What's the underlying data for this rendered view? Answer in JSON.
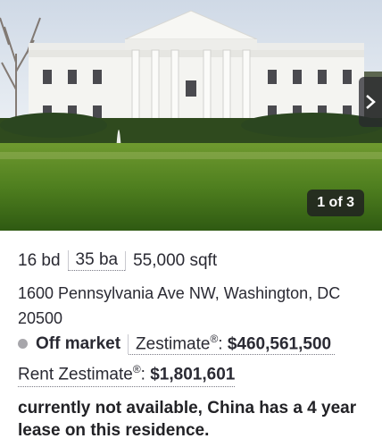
{
  "gallery": {
    "counter": "1 of 3",
    "next_icon": "chevron-right-icon"
  },
  "listing": {
    "beds": "16 bd",
    "baths": "35 ba",
    "sqft": "55,000 sqft",
    "address": "1600 Pennsylvania Ave NW, Washington, DC 20500",
    "status": "Off market",
    "status_dot_color": "#a7a6ab",
    "zestimate_label": "Zestimate",
    "zestimate_mark": "®",
    "zestimate_value": "$460,561,500",
    "rent_label": "Rent Zestimate",
    "rent_mark": "®",
    "rent_value": "$1,801,601",
    "note": "currently not available, China has a 4 year lease on this residence."
  }
}
